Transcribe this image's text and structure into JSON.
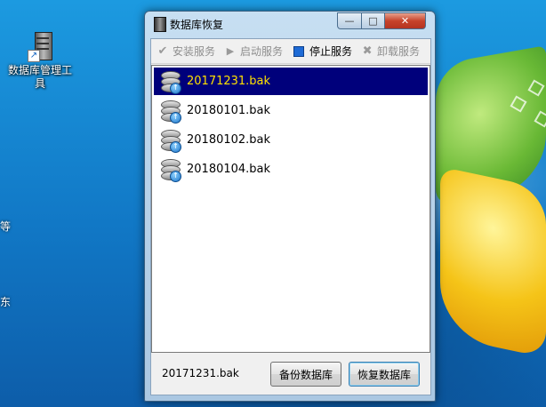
{
  "desktop": {
    "icon_label": "数据库管理工具",
    "edge_glyph_1": "等",
    "edge_glyph_2": "东"
  },
  "window": {
    "title": "数据库恢复",
    "controls": {
      "minimize": "—",
      "maximize": "□",
      "close": "✕"
    }
  },
  "toolbar": {
    "items": [
      {
        "label": "安装服务",
        "icon": "check-icon",
        "enabled": false
      },
      {
        "label": "启动服务",
        "icon": "play-icon",
        "enabled": false
      },
      {
        "label": "停止服务",
        "icon": "stop-icon",
        "enabled": true
      },
      {
        "label": "卸载服务",
        "icon": "x-icon",
        "enabled": false
      }
    ]
  },
  "files": {
    "items": [
      {
        "name": "20171231.bak",
        "selected": true
      },
      {
        "name": "20180101.bak",
        "selected": false
      },
      {
        "name": "20180102.bak",
        "selected": false
      },
      {
        "name": "20180104.bak",
        "selected": false
      }
    ]
  },
  "status": {
    "selected_file": "20171231.bak"
  },
  "buttons": {
    "backup": "备份数据库",
    "restore": "恢复数据库"
  },
  "colors": {
    "selection_bg": "#00007b",
    "selection_text": "#ffe000",
    "stop_icon": "#1e6bd6",
    "close_button": "#c7432b"
  }
}
